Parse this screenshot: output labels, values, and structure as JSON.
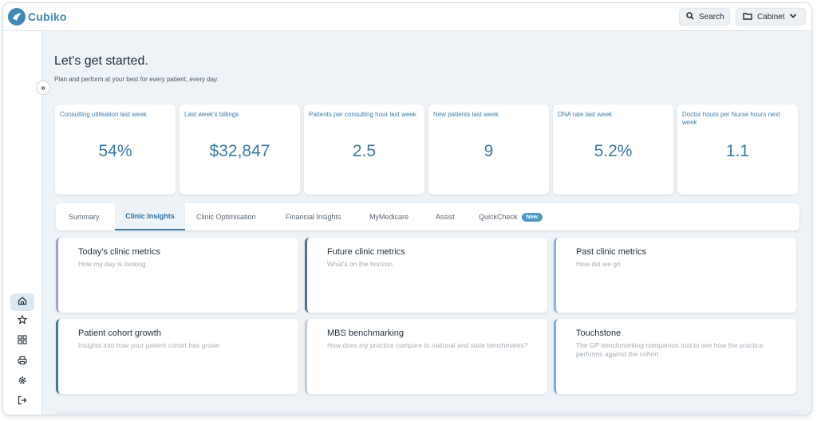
{
  "app": {
    "name": "Cubiko"
  },
  "topbar": {
    "search_label": "Search",
    "cabinet_label": "Cabinet"
  },
  "sidebar": {
    "items": [
      {
        "name": "home",
        "icon": "home-icon"
      },
      {
        "name": "favourites",
        "icon": "star-icon"
      },
      {
        "name": "cabinet",
        "icon": "grid-icon"
      },
      {
        "name": "print",
        "icon": "printer-icon"
      },
      {
        "name": "settings",
        "icon": "gear-icon"
      },
      {
        "name": "logout",
        "icon": "logout-icon"
      }
    ]
  },
  "page": {
    "title": "Let's get started.",
    "subtitle": "Plan and perform at your best for every patient, every day."
  },
  "metrics": [
    {
      "label": "Consulting utilisation last week",
      "value": "54%"
    },
    {
      "label": "Last week's billings",
      "value": "$32,847"
    },
    {
      "label": "Patients per consulting hour last week",
      "value": "2.5"
    },
    {
      "label": "New patients last week",
      "value": "9"
    },
    {
      "label": "DNA rate last week",
      "value": "5.2%"
    },
    {
      "label": "Doctor hours per Nurse hours next week",
      "value": "1.1"
    }
  ],
  "tabs": [
    {
      "label": "Summary",
      "active": false
    },
    {
      "label": "Clinic Insights",
      "active": true
    },
    {
      "label": "Clinic Optimisation",
      "active": false
    },
    {
      "label": "Financial Insights",
      "active": false
    },
    {
      "label": "MyMedicare",
      "active": false
    },
    {
      "label": "Assist",
      "active": false
    },
    {
      "label": "QuickCheck",
      "active": false,
      "badge": "New"
    }
  ],
  "insights": [
    {
      "title": "Today's clinic metrics",
      "desc": "How my day is looking",
      "accent": "#a99cd0"
    },
    {
      "title": "Future clinic metrics",
      "desc": "What's on the horizon",
      "accent": "#4f6f94"
    },
    {
      "title": "Past clinic metrics",
      "desc": "How did we go",
      "accent": "#8fb3d6"
    },
    {
      "title": "Patient cohort growth",
      "desc": "Insights into how your patient cohort has grown",
      "accent": "#3b7f8c"
    },
    {
      "title": "MBS benchmarking",
      "desc": "How does my practice compare to national and state benchmarks?",
      "accent": "#c5ccd3"
    },
    {
      "title": "Touchstone",
      "desc": "The GP benchmarking companion tool to see how the practice performs against the cohort",
      "accent": "#7faad6"
    }
  ],
  "colors": {
    "brand": "#3f88b7",
    "accent_text": "#3c7aa3",
    "background": "#eef3f7"
  }
}
